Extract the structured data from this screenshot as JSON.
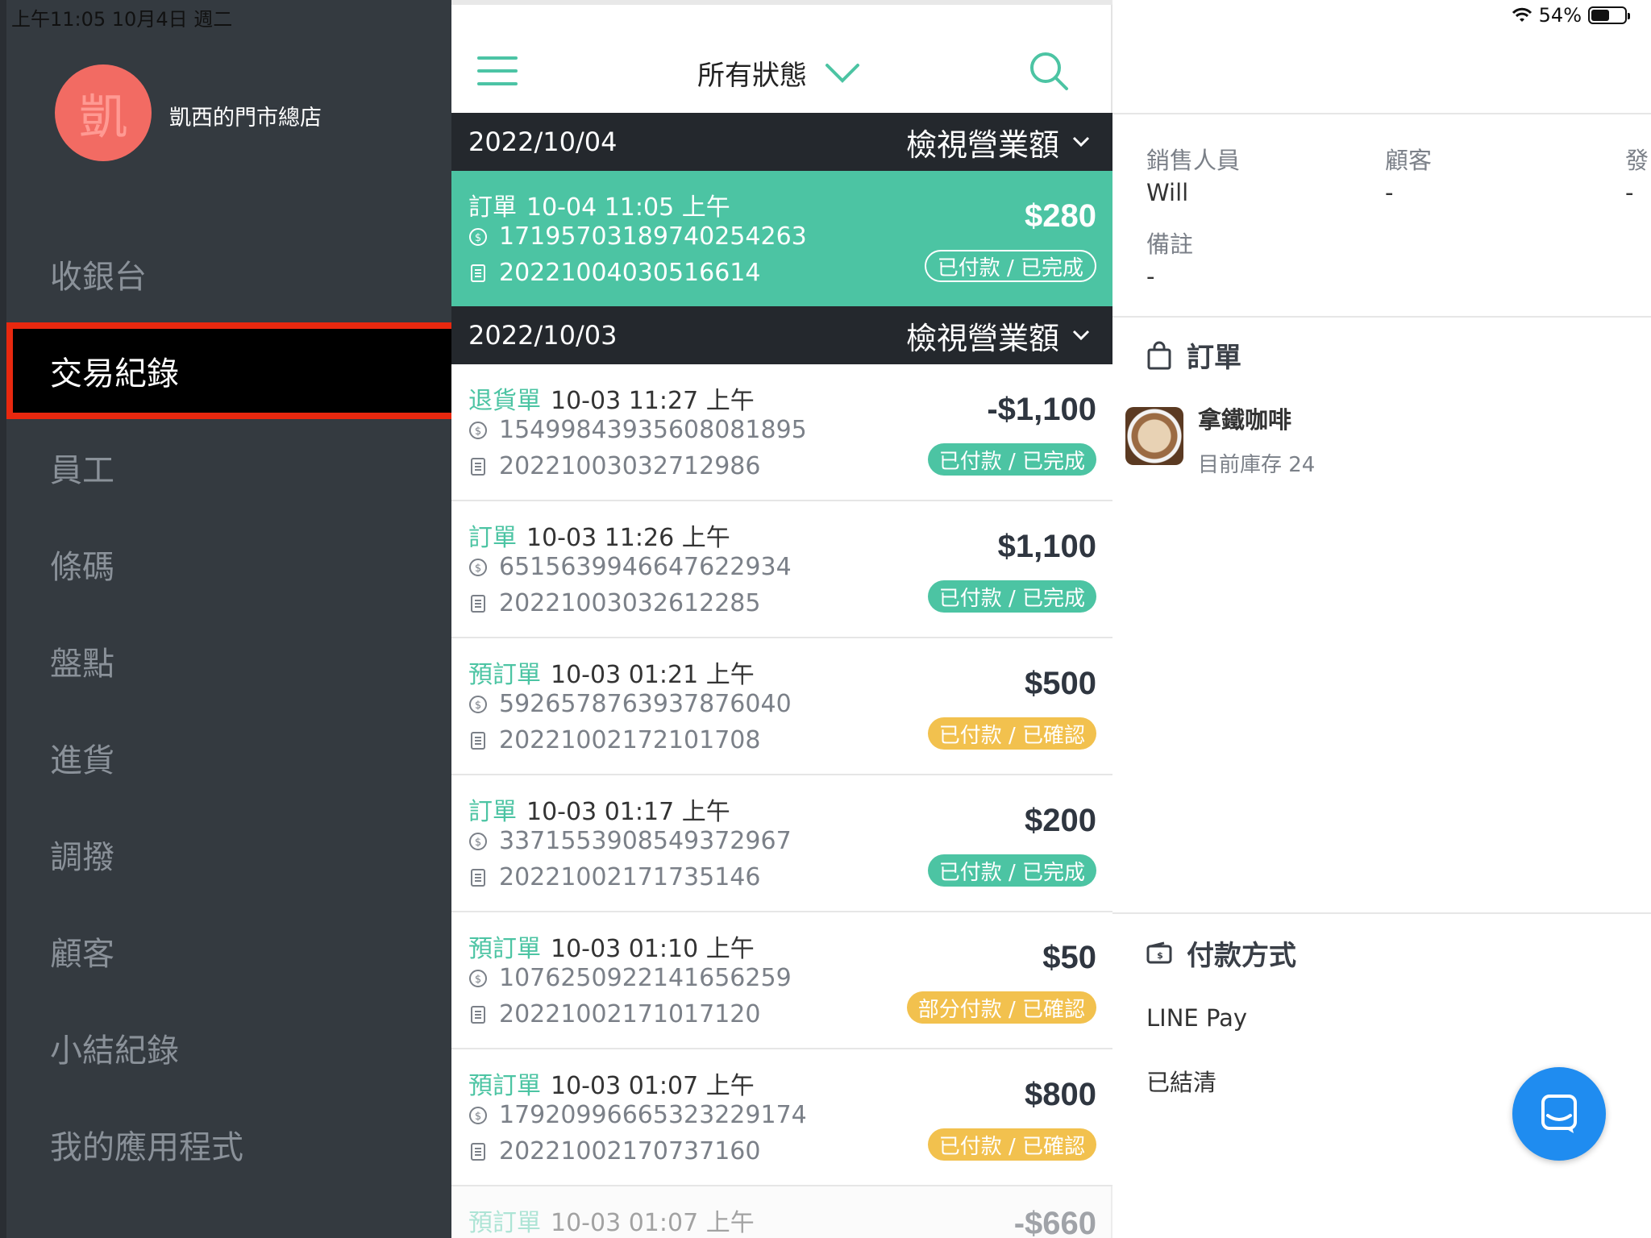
{
  "status_bar": {
    "time_date": "上午11:05   10月4日 週二",
    "battery_text": "54%",
    "battery_level": 0.54
  },
  "sidebar": {
    "avatar_char": "凱",
    "store_name": "凱西的門市總店",
    "items": [
      {
        "label": "收銀台"
      },
      {
        "label": "交易紀錄"
      },
      {
        "label": "員工"
      },
      {
        "label": "條碼"
      },
      {
        "label": "盤點"
      },
      {
        "label": "進貨"
      },
      {
        "label": "調撥"
      },
      {
        "label": "顧客"
      },
      {
        "label": "小結紀錄"
      },
      {
        "label": "我的應用程式"
      }
    ],
    "active_index": 1
  },
  "list": {
    "filter_label": "所有狀態",
    "date_groups": [
      {
        "date": "2022/10/04",
        "view_revenue": "檢視營業額"
      },
      {
        "date": "2022/10/03",
        "view_revenue": "檢視營業額"
      }
    ],
    "transactions": [
      {
        "type": "訂單",
        "time": "10-04 11:05 上午",
        "payment_id": "17195703189740254263",
        "order_no": "20221004030516614",
        "amount": "$280",
        "status": "已付款 / 已完成"
      },
      {
        "type": "退貨單",
        "time": "10-03 11:27 上午",
        "payment_id": "15499843935608081895",
        "order_no": "20221003032712986",
        "amount": "-$1,100",
        "status": "已付款 / 已完成"
      },
      {
        "type": "訂單",
        "time": "10-03 11:26 上午",
        "payment_id": "6515639946647622934",
        "order_no": "20221003032612285",
        "amount": "$1,100",
        "status": "已付款 / 已完成"
      },
      {
        "type": "預訂單",
        "time": "10-03 01:21 上午",
        "payment_id": "5926578763937876040",
        "order_no": "20221002172101708",
        "amount": "$500",
        "status": "已付款 / 已確認"
      },
      {
        "type": "訂單",
        "time": "10-03 01:17 上午",
        "payment_id": "3371553908549372967",
        "order_no": "20221002171735146",
        "amount": "$200",
        "status": "已付款 / 已完成"
      },
      {
        "type": "預訂單",
        "time": "10-03 01:10 上午",
        "payment_id": "1076250922141656259",
        "order_no": "20221002171017120",
        "amount": "$50",
        "status": "部分付款 / 已確認"
      },
      {
        "type": "預訂單",
        "time": "10-03 01:07 上午",
        "payment_id": "17920996665323229174",
        "order_no": "20221002170737160",
        "amount": "$800",
        "status": "已付款 / 已確認"
      },
      {
        "type": "預訂單",
        "time": "10-03 01:07 上午",
        "amount": "-$660"
      }
    ]
  },
  "detail": {
    "salesperson_label": "銷售人員",
    "salesperson_value": "Will",
    "customer_label": "顧客",
    "customer_value": "-",
    "invoice_label": "發",
    "invoice_value": "-",
    "note_label": "備註",
    "note_value": "-",
    "order_section": "訂單",
    "product_name": "拿鐵咖啡",
    "product_stock": "目前庫存 24",
    "payment_section": "付款方式",
    "payment_method": "LINE Pay",
    "payment_status": "已結清"
  },
  "colors": {
    "accent": "#4cc4a3",
    "sidebar_bg": "#343a40",
    "date_bar_bg": "#24282d",
    "badge_yellow": "#f2c14e",
    "highlight_border": "#e8280f",
    "chat_button": "#1f8cf0"
  }
}
